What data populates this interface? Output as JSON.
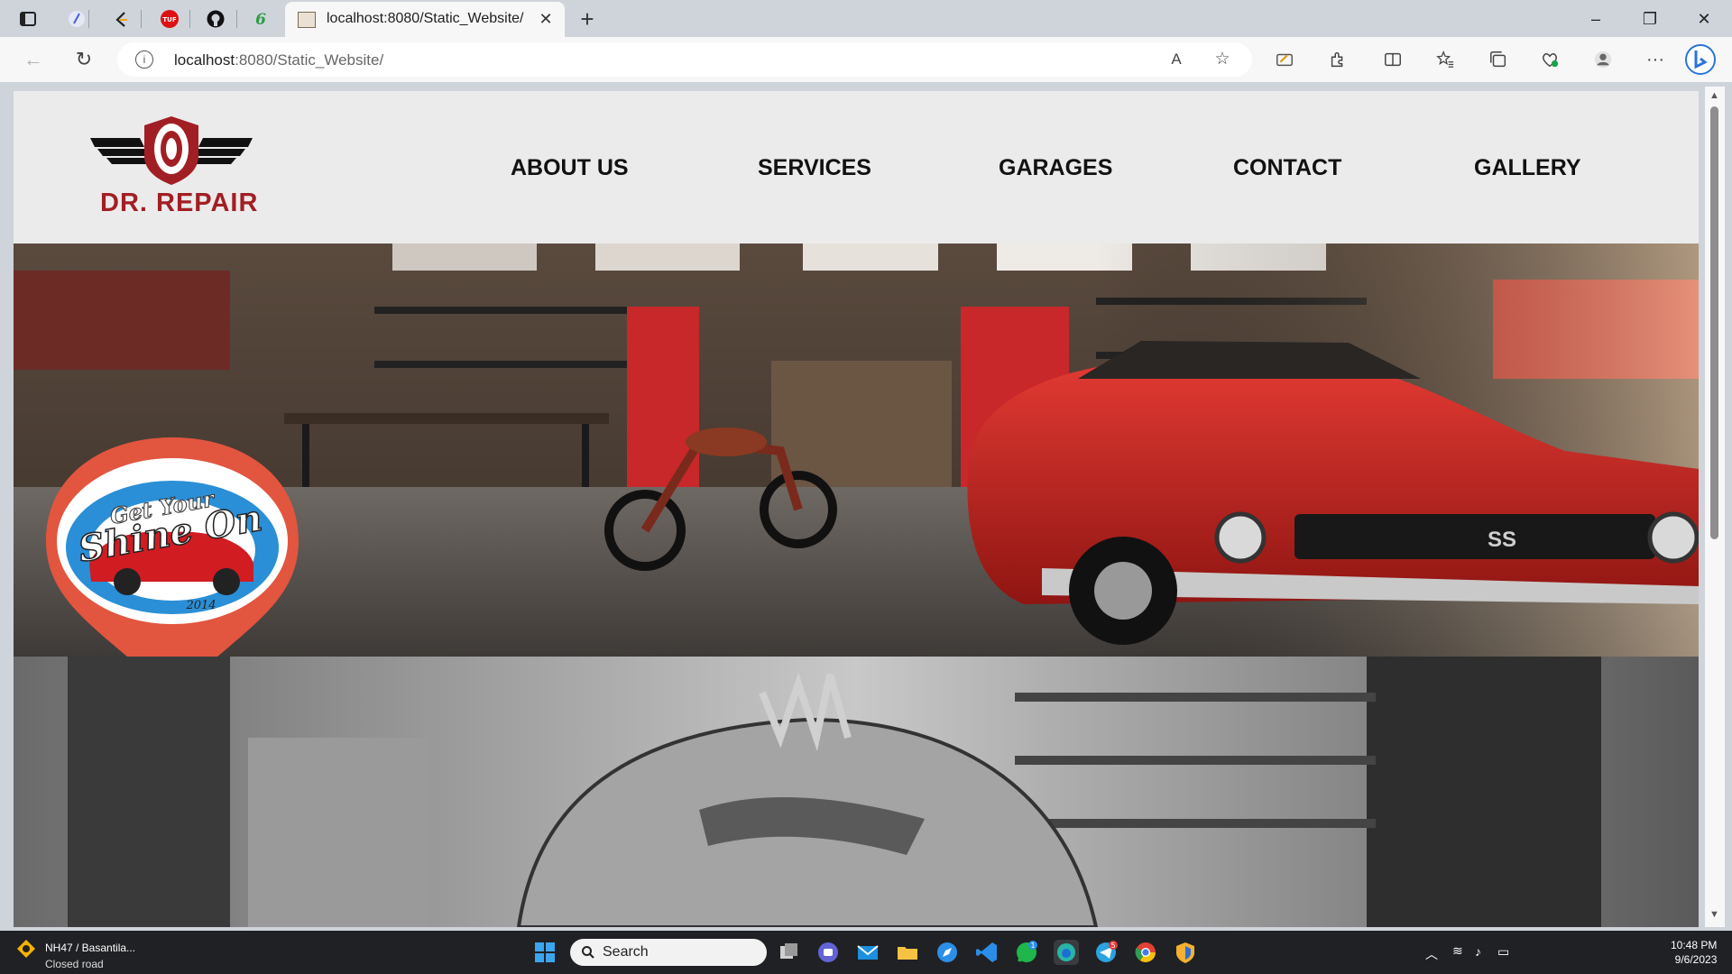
{
  "browser": {
    "tab_title": "localhost:8080/Static_Website/",
    "url_host": "localhost",
    "url_path": ":8080/Static_Website/",
    "tab_close": "✕",
    "new_tab": "+",
    "window": {
      "minimize": "–",
      "restore": "❐",
      "close": "✕"
    },
    "nav": {
      "back": "←",
      "refresh": "↻",
      "info": "i"
    },
    "toolbar_icons": {
      "read_aloud": "A",
      "favorite": "☆",
      "more": "···"
    }
  },
  "site": {
    "logo_text": "DR. REPAIR",
    "nav": [
      "ABOUT US",
      "SERVICES",
      "GARAGES",
      "CONTACT",
      "GALLERY"
    ],
    "badge_line1": "Get Your",
    "badge_line2": "Shine On",
    "badge_year": "2014",
    "car_plate": "SS"
  },
  "taskbar": {
    "weather_title": "NH47 / Basantila...",
    "weather_sub": "Closed road",
    "search_label": "Search",
    "time": "10:48 PM",
    "date": "9/6/2023",
    "telegram_badge": "5",
    "whatsapp_badge": "1"
  },
  "colors": {
    "brand_red": "#a11f24",
    "badge_orange": "#e2553f",
    "badge_blue": "#2a8fd6"
  }
}
